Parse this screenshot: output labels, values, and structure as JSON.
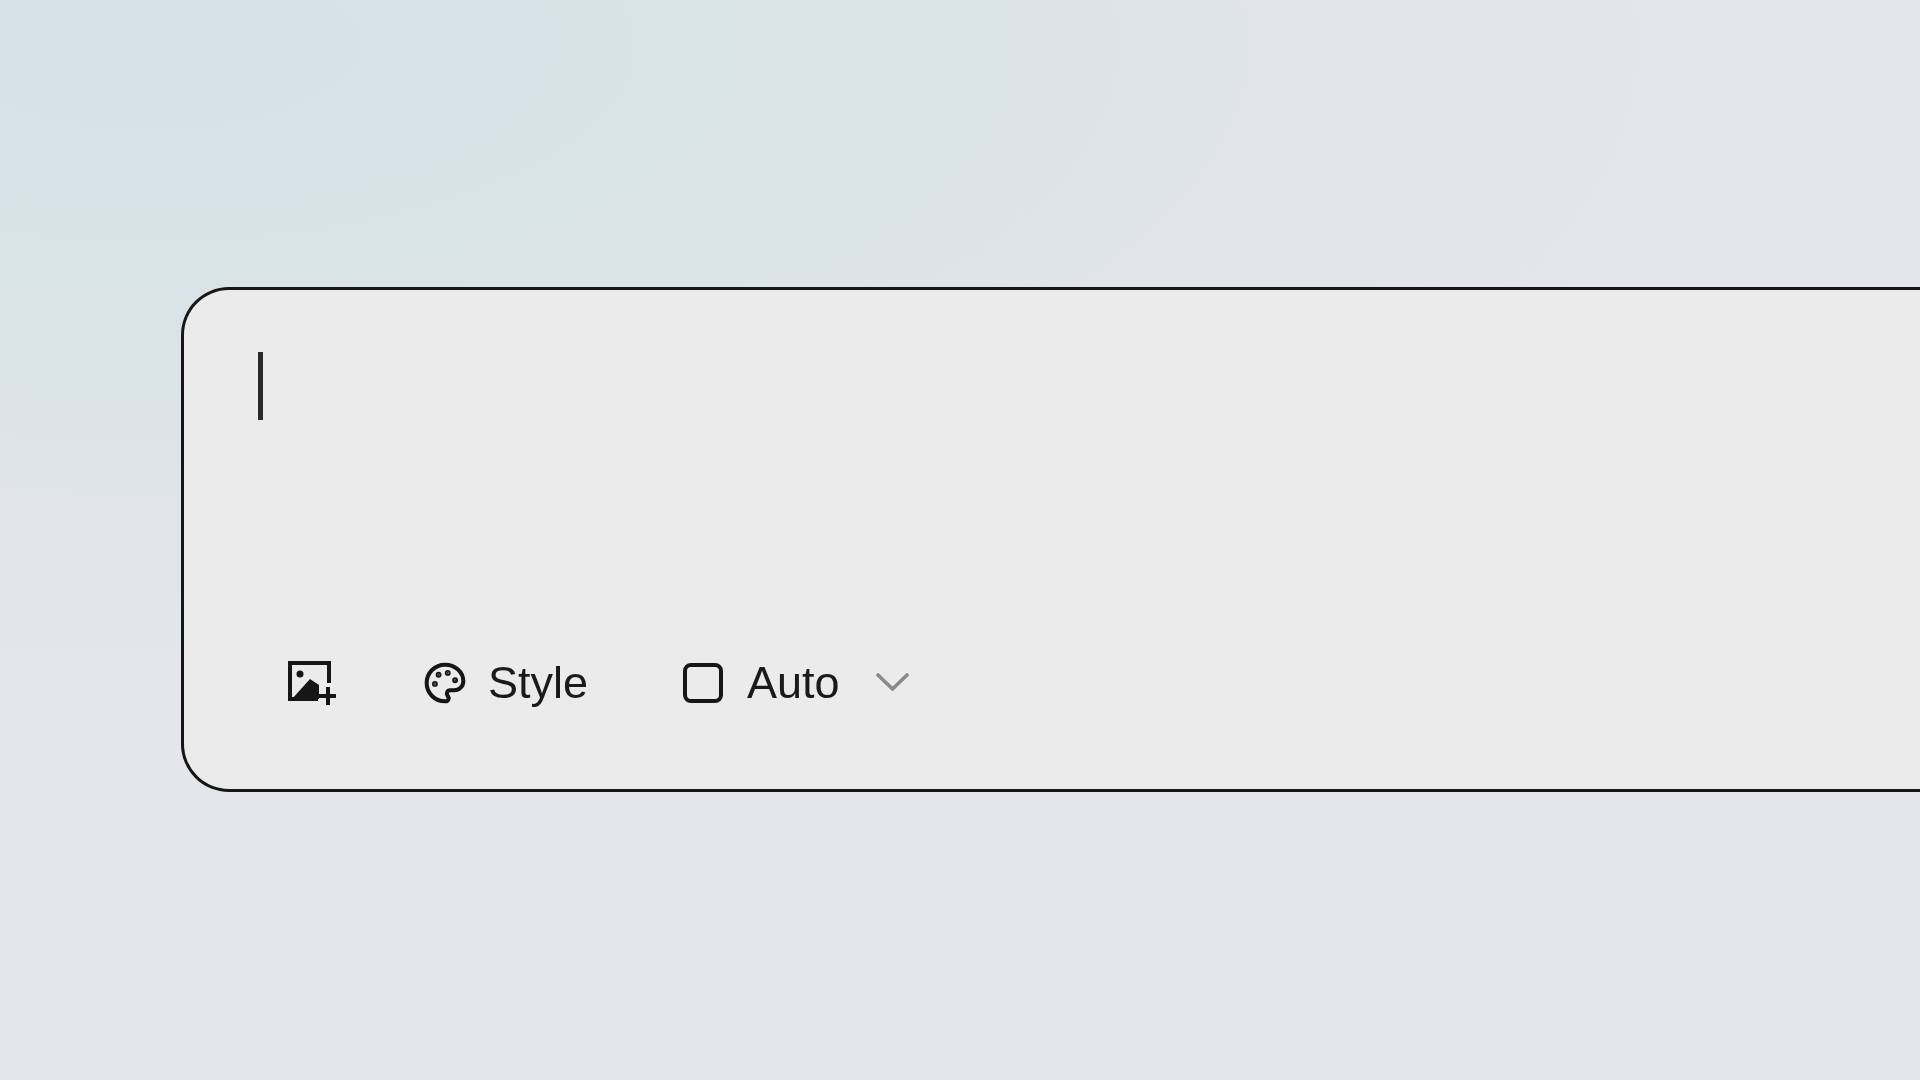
{
  "composer": {
    "prompt_field": {
      "focused": true
    },
    "style_button": {
      "label": "Style"
    },
    "dropdown": {
      "value": "Auto"
    }
  }
}
